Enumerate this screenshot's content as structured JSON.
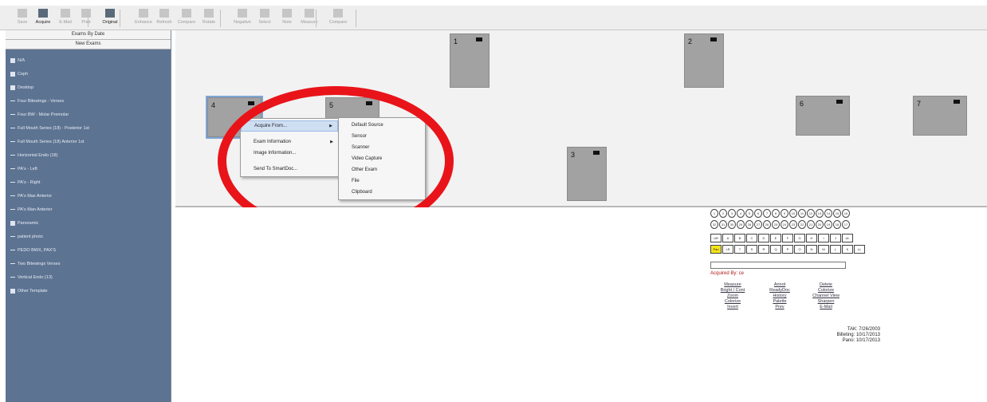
{
  "toolbar": {
    "buttons": [
      {
        "label": "Save",
        "enabled": false
      },
      {
        "label": "Acquire",
        "enabled": true
      },
      {
        "label": "E-Mail",
        "enabled": false
      },
      {
        "label": "Print",
        "enabled": false
      },
      {
        "label": "Original",
        "enabled": true
      },
      {
        "label": "Enhance",
        "enabled": false
      },
      {
        "label": "Refresh",
        "enabled": false
      },
      {
        "label": "Compare",
        "enabled": false
      },
      {
        "label": "Rotate",
        "enabled": false
      },
      {
        "label": "Negative",
        "enabled": false
      },
      {
        "label": "Select",
        "enabled": false
      },
      {
        "label": "Note",
        "enabled": false
      },
      {
        "label": "Measure",
        "enabled": false
      },
      {
        "label": "Compare",
        "enabled": false
      }
    ]
  },
  "sidebar": {
    "exams_by_date": "Exams By Date",
    "new_exams": "New Exams",
    "items": [
      "N/A",
      "Ceph",
      "Desktop",
      "Four Bitewings - Verses",
      "Four BW - Molar Premolar",
      "Full Mouth Series (18) - Posterior 1st",
      "Full Mouth Series (18) Anterior 1st",
      "Horizontal Endo (18)",
      "PA's - Left",
      "PA's - Right",
      "PA's Max Anterior",
      "PA's Man Anterior",
      "Panoramic",
      "patient photo",
      "PEDO BWX, PAX'S",
      "Two Bitewings Verses",
      "Vertical Endo (13)",
      "Other Template"
    ]
  },
  "slots": [
    "1",
    "2",
    "3",
    "4",
    "5",
    "6",
    "7"
  ],
  "context_menu": {
    "items": [
      "Acquire From...",
      "Exam Information",
      "Image Information...",
      "Send To SmartDoc..."
    ],
    "submenu": [
      "Default Source",
      "Sensor",
      "Scanner",
      "Video Capture",
      "Other Exam",
      "File",
      "Clipboard"
    ]
  },
  "detail": {
    "acquired_by": "Acquired By: ce",
    "col1": [
      "Measure",
      "Bright / Cont",
      "Zoom",
      "Colorize",
      "Invert"
    ],
    "col2": [
      "Annot",
      "ReadyDoc",
      "History",
      "Palette",
      "Prev"
    ],
    "col3": [
      "Delete",
      "Colorize",
      "Channel View",
      "Sharpen",
      "E-Mail"
    ],
    "dates": [
      "TAK: 7/26/2003",
      "Billeting: 10/17/2013",
      "Pano: 10/17/2013"
    ],
    "row1": [
      "1",
      "2",
      "3",
      "4",
      "5",
      "6",
      "7",
      "8",
      "9",
      "10",
      "11",
      "12",
      "13",
      "14",
      "15",
      "16"
    ],
    "row2": [
      "32",
      "31",
      "30",
      "29",
      "28",
      "27",
      "26",
      "25",
      "24",
      "23",
      "22",
      "21",
      "20",
      "19",
      "18",
      "17"
    ],
    "row3": [
      "UR",
      "A",
      "B",
      "C",
      "D",
      "E",
      "F",
      "G",
      "H",
      "I",
      "J",
      "UL"
    ],
    "row4": [
      "Pan",
      "LR",
      "T",
      "S",
      "R",
      "Q",
      "P",
      "O",
      "N",
      "M",
      "L",
      "K",
      "LL"
    ],
    "accent_yellow": "#f5e41a",
    "annotation_red": "#e8141a"
  }
}
